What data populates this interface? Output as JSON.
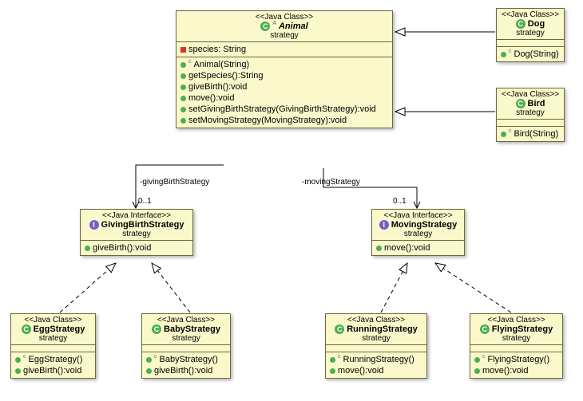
{
  "stereotypes": {
    "class": "<<Java Class>>",
    "interface": "<<Java Interface>>"
  },
  "pkg": "strategy",
  "animal": {
    "name": "Animal",
    "attr1": "species: String",
    "m1": "Animal(String)",
    "m2": "getSpecies():String",
    "m3": "giveBirth():void",
    "m4": "move():void",
    "m5": "setGivingBirthStrategy(GivingBirthStrategy):void",
    "m6": "setMovingStrategy(MovingStrategy):void"
  },
  "dog": {
    "name": "Dog",
    "m1": "Dog(String)"
  },
  "bird": {
    "name": "Bird",
    "m1": "Bird(String)"
  },
  "gbs": {
    "name": "GivingBirthStrategy",
    "m1": "giveBirth():void"
  },
  "ms": {
    "name": "MovingStrategy",
    "m1": "move():void"
  },
  "egg": {
    "name": "EggStrategy",
    "m1": "EggStrategy()",
    "m2": "giveBirth():void"
  },
  "baby": {
    "name": "BabyStrategy",
    "m1": "BabyStrategy()",
    "m2": "giveBirth():void"
  },
  "run": {
    "name": "RunningStrategy",
    "m1": "RunningStrategy()",
    "m2": "move():void"
  },
  "fly": {
    "name": "FlyingStrategy",
    "m1": "FlyingStrategy()",
    "m2": "move():void"
  },
  "assoc": {
    "gbs_role": "-givingBirthStrategy",
    "gbs_mult": "0..1",
    "ms_role": "-movingStrategy",
    "ms_mult": "0..1"
  }
}
